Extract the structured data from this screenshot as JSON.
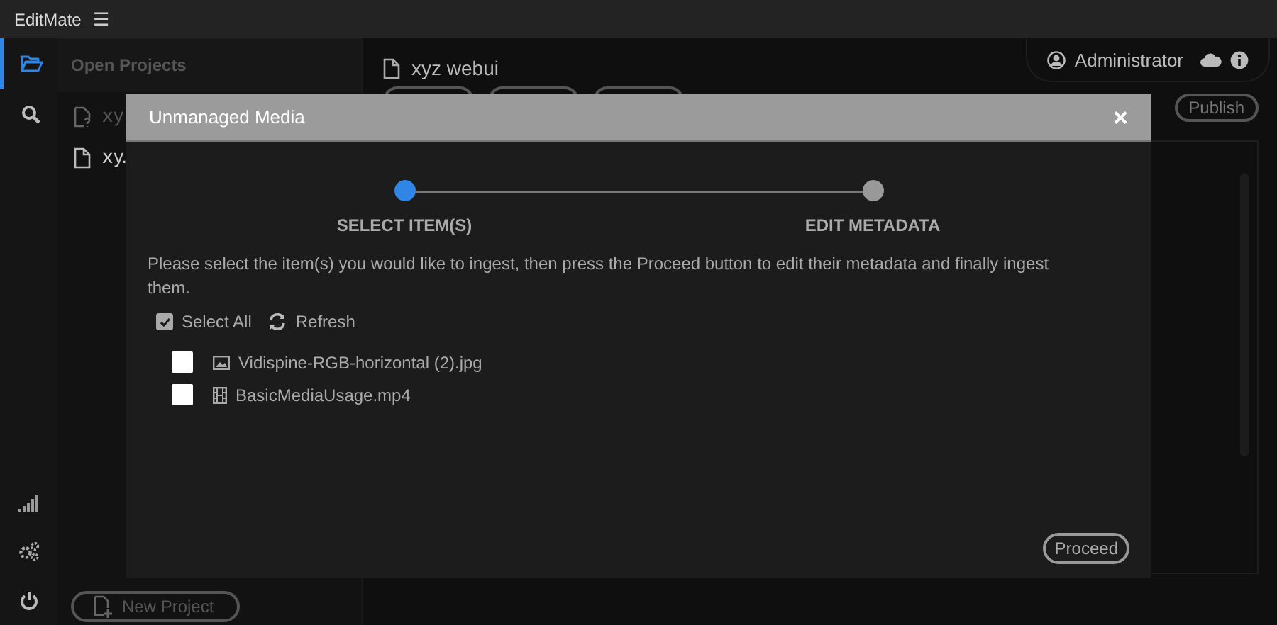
{
  "app": {
    "title": "EditMate",
    "menu_icon": "☰"
  },
  "rail": [
    {
      "kind": "folder",
      "selected": true
    },
    {
      "kind": "search",
      "selected": false
    }
  ],
  "rail_bottom": [
    {
      "kind": "signal"
    },
    {
      "kind": "gears"
    },
    {
      "kind": "power"
    }
  ],
  "projects": {
    "title": "Open Projects",
    "items": [
      {
        "kind": "unknown",
        "label": "xy"
      },
      {
        "kind": "file",
        "label": "xy."
      }
    ],
    "new_button": "New Project"
  },
  "main": {
    "title": "xyz webui",
    "publish": "Publish"
  },
  "user": {
    "name": "Administrator"
  },
  "modal": {
    "title": "Unmanaged Media",
    "close": "×",
    "steps": [
      {
        "label": "SELECT ITEM(S)",
        "selected": true
      },
      {
        "label": "EDIT METADATA",
        "selected": false
      }
    ],
    "instructions": "Please select the item(s) you would like to ingest, then press the Proceed button to edit their metadata and finally ingest them.",
    "select_all": {
      "label": "Select All",
      "checked": true
    },
    "refresh": "Refresh",
    "items": [
      {
        "kind": "image",
        "name": "Vidispine-RGB-horizontal (2).jpg",
        "checked": false
      },
      {
        "kind": "video",
        "name": "BasicMediaUsage.mp4",
        "checked": false
      }
    ],
    "proceed": "Proceed"
  }
}
